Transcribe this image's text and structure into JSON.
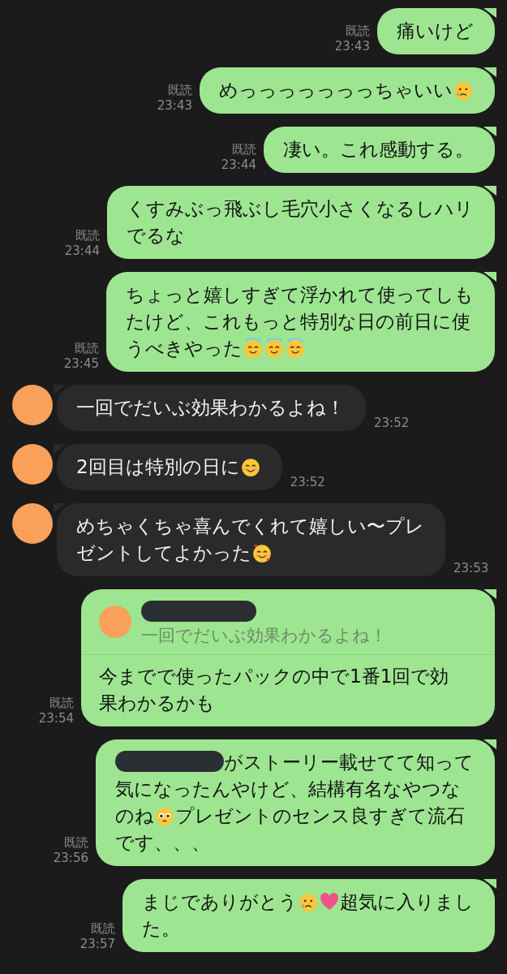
{
  "messages": [
    {
      "kind": "sent",
      "read": "既読",
      "time": "23:43",
      "lines": [
        [
          {
            "kind": "text",
            "text": "痛いけど"
          }
        ]
      ]
    },
    {
      "kind": "sent",
      "read": "既読",
      "time": "23:43",
      "lines": [
        [
          {
            "kind": "text",
            "text": "めっっっっっっっちゃいい"
          },
          {
            "kind": "tear"
          }
        ]
      ]
    },
    {
      "kind": "sent",
      "read": "既読",
      "time": "23:44",
      "lines": [
        [
          {
            "kind": "text",
            "text": "凄い。これ感動する。"
          }
        ]
      ]
    },
    {
      "kind": "sent",
      "read": "既読",
      "time": "23:44",
      "lines": [
        [
          {
            "kind": "text",
            "text": "くすみぶっ飛ぶし毛穴小さくなるしハリ"
          }
        ],
        [
          {
            "kind": "text",
            "text": "でるな"
          }
        ]
      ]
    },
    {
      "kind": "sent",
      "read": "既読",
      "time": "23:45",
      "lines": [
        [
          {
            "kind": "text",
            "text": "ちょっと嬉しすぎて浮かれて使ってしも"
          }
        ],
        [
          {
            "kind": "text",
            "text": "たけど、これもっと特別な日の前日に使"
          }
        ],
        [
          {
            "kind": "text",
            "text": "うべきやった"
          },
          {
            "kind": "halo"
          },
          {
            "kind": "halo"
          },
          {
            "kind": "halo"
          }
        ]
      ]
    },
    {
      "kind": "received",
      "time": "23:52",
      "lines": [
        [
          {
            "kind": "text",
            "text": "一回でだいぶ効果わかるよね！"
          }
        ]
      ]
    },
    {
      "kind": "received",
      "time": "23:52",
      "lines": [
        [
          {
            "kind": "text",
            "text": "2回目は特別の日に"
          },
          {
            "kind": "blush"
          }
        ]
      ]
    },
    {
      "kind": "received",
      "time": "23:53",
      "lines": [
        [
          {
            "kind": "text",
            "text": "めちゃくちゃ喜んでくれて嬉しい〜プレ"
          }
        ],
        [
          {
            "kind": "text",
            "text": "ゼントしてよかった"
          },
          {
            "kind": "hearts"
          }
        ]
      ]
    },
    {
      "kind": "sent",
      "read": "既読",
      "time": "23:54",
      "quote": {
        "name_parts": [
          {
            "kind": "redacted"
          }
        ],
        "text_parts": [
          {
            "kind": "text",
            "text": "一回でだいぶ効果わかるよね！"
          }
        ]
      },
      "lines": [
        [
          {
            "kind": "text",
            "text": "今までで使ったパックの中で1番1回で効"
          }
        ],
        [
          {
            "kind": "text",
            "text": "果わかるかも"
          }
        ]
      ]
    },
    {
      "kind": "sent",
      "read": "既読",
      "time": "23:56",
      "lines": [
        [
          {
            "kind": "redacted"
          },
          {
            "kind": "text",
            "text": "がストーリー載せてて知って"
          }
        ],
        [
          {
            "kind": "text",
            "text": "気になったんやけど、結構有名なやつな"
          }
        ],
        [
          {
            "kind": "text",
            "text": "のね"
          },
          {
            "kind": "pleading"
          },
          {
            "kind": "text",
            "text": "プレゼントのセンス良すぎて流石"
          }
        ],
        [
          {
            "kind": "text",
            "text": "です、、、"
          }
        ]
      ]
    },
    {
      "kind": "sent",
      "read": "既読",
      "time": "23:57",
      "lines": [
        [
          {
            "kind": "text",
            "text": "まじでありがとう"
          },
          {
            "kind": "tear"
          },
          {
            "kind": "heart"
          },
          {
            "kind": "text",
            "text": "超気に入りまし"
          }
        ],
        [
          {
            "kind": "text",
            "text": "た。"
          }
        ]
      ]
    }
  ]
}
